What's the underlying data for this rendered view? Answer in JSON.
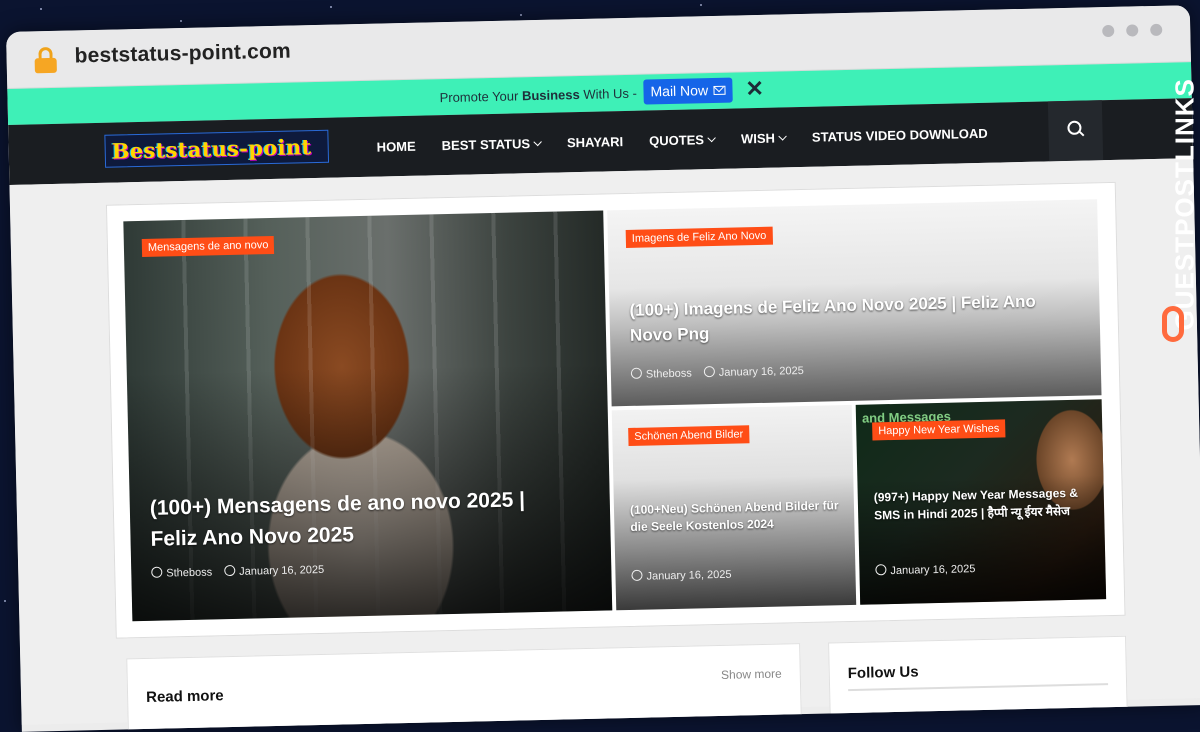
{
  "browser": {
    "url": "beststatus-point.com"
  },
  "promo": {
    "text_prefix": "Promote Your ",
    "text_bold": "Business",
    "text_suffix": " With Us -",
    "button_label": "Mail Now",
    "close_symbol": "✕"
  },
  "nav": {
    "logo_text": "Beststatus-point",
    "items": [
      {
        "label": "HOME",
        "dropdown": false
      },
      {
        "label": "BEST STATUS",
        "dropdown": true
      },
      {
        "label": "SHAYARI",
        "dropdown": false
      },
      {
        "label": "QUOTES",
        "dropdown": true
      },
      {
        "label": "WISH",
        "dropdown": true
      },
      {
        "label": "STATUS VIDEO DOWNLOAD",
        "dropdown": false
      }
    ]
  },
  "featured": [
    {
      "category": "Mensagens de ano novo",
      "title": "(100+) Mensagens de ano novo 2025 | Feliz Ano Novo 2025",
      "author": "Stheboss",
      "date": "January 16, 2025"
    },
    {
      "category": "Imagens de Feliz Ano Novo",
      "title": "(100+) Imagens de Feliz Ano Novo 2025 | Feliz Ano Novo Png",
      "author": "Stheboss",
      "date": "January 16, 2025"
    },
    {
      "category": "Schönen Abend Bilder",
      "title": "(100+Neu) Schönen Abend Bilder für die Seele Kostenlos 2024",
      "date": "January 16, 2025"
    },
    {
      "category": "Happy New Year Wishes",
      "title": "(997+) Happy New Year Messages & SMS in Hindi 2025 | हैप्पी न्यू ईयर मैसेज",
      "date": "January 16, 2025",
      "image_text": "and Messages"
    }
  ],
  "sections": {
    "read_more_title": "Read more",
    "show_more": "Show more",
    "follow_title": "Follow Us"
  },
  "watermark": {
    "text": "GUESTPOSTLINKS"
  },
  "colors": {
    "promo_bg": "#3ef0b7",
    "nav_bg": "#1a1d21",
    "badge": "#ff4d16",
    "mail_button": "#1565e8"
  }
}
